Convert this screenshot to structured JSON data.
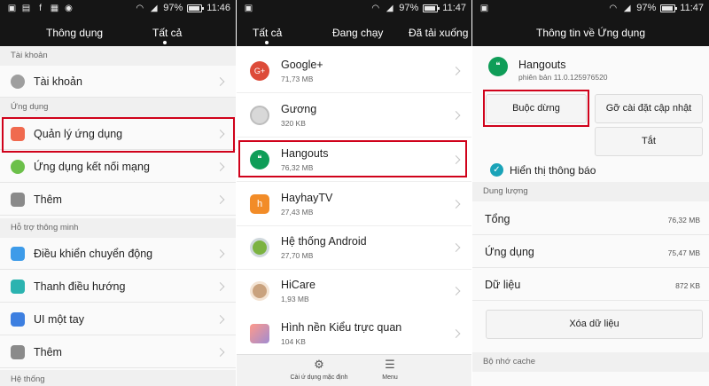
{
  "status_bars": [
    {
      "battery": "97%",
      "time": "11:46"
    },
    {
      "battery": "97%",
      "time": "11:47"
    },
    {
      "battery": "97%",
      "time": "11:47"
    }
  ],
  "screen1": {
    "tabs": [
      "Thông dụng",
      "Tất cả"
    ],
    "sections": {
      "account": "Tài khoản",
      "apps": "Ứng dụng",
      "smart": "Hỗ trợ thông minh",
      "system": "Hệ thống"
    },
    "items": {
      "account": "Tài khoản",
      "app_manager": "Quản lý ứng dụng",
      "connected_apps": "Ứng dụng kết nối mạng",
      "more1": "Thêm",
      "motion": "Điều khiển chuyển động",
      "nav_bar": "Thanh điều hướng",
      "one_hand": "UI một tay",
      "more2": "Thêm"
    }
  },
  "screen2": {
    "tabs": [
      "Tất cả",
      "Đang chạy",
      "Đã tải xuống"
    ],
    "apps": [
      {
        "name": "Google+",
        "size": "71,73 MB"
      },
      {
        "name": "Gương",
        "size": "320 KB"
      },
      {
        "name": "Hangouts",
        "size": "76,32 MB"
      },
      {
        "name": "HayhayTV",
        "size": "27,43 MB"
      },
      {
        "name": "Hệ thống Android",
        "size": "27,70 MB"
      },
      {
        "name": "HiCare",
        "size": "1,93 MB"
      },
      {
        "name": "Hình nền Kiểu trực quan",
        "size": "104 KB"
      }
    ],
    "bottom": {
      "defaults": "Cài ứ dụng mặc định",
      "menu": "Menu"
    }
  },
  "screen3": {
    "title": "Thông tin về Ứng dụng",
    "app_name": "Hangouts",
    "version": "phiên bản 11.0.125976520",
    "force_stop": "Buộc dừng",
    "uninstall_updates": "Gỡ cài đặt cập nhật",
    "disable": "Tắt",
    "show_notifications": "Hiển thị thông báo",
    "storage_header": "Dung lượng",
    "storage": [
      {
        "label": "Tổng",
        "value": "76,32 MB"
      },
      {
        "label": "Ứng dụng",
        "value": "75,47 MB"
      },
      {
        "label": "Dữ liệu",
        "value": "872 KB"
      }
    ],
    "clear_data": "Xóa dữ liệu",
    "cache_header": "Bộ nhớ cache"
  },
  "colors": {
    "highlight": "#d0021b",
    "topbar": "#151515",
    "accent": "#1aa3b8"
  }
}
